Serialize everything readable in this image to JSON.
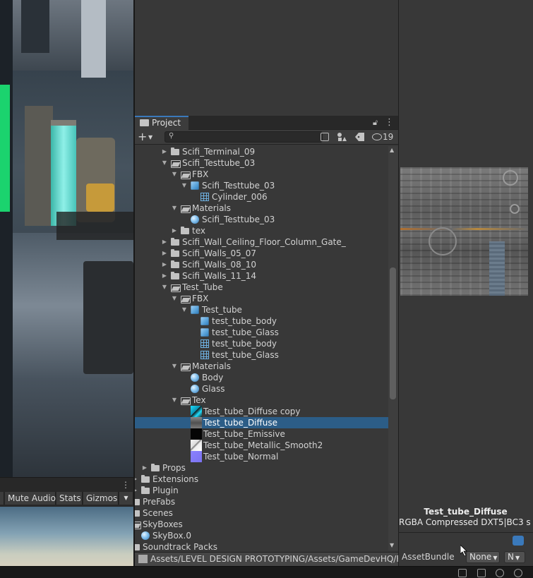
{
  "game_toolbar": {
    "mute_audio_label": "Mute Audio",
    "stats_label": "Stats",
    "gizmos_label": "Gizmos"
  },
  "project_panel": {
    "tab_label": "Project",
    "search": {
      "value": "",
      "placeholder": ""
    },
    "hidden_count": "19",
    "path": "Assets/LEVEL DESIGN PROTOTYPING/Assets/GameDevHQ/Fi"
  },
  "tree": [
    {
      "label": "Scifi_Terminal_09",
      "icon": "folder-icon",
      "expanded": false
    },
    {
      "label": "Scifi_Testtube_03",
      "icon": "folder-open-icon",
      "expanded": true
    },
    {
      "label": "FBX",
      "icon": "folder-open-icon",
      "expanded": true
    },
    {
      "label": "Scifi_Testtube_03",
      "icon": "model-icon",
      "expanded": true
    },
    {
      "label": "Cylinder_006",
      "icon": "mesh-icon"
    },
    {
      "label": "Materials",
      "icon": "folder-open-icon",
      "expanded": true
    },
    {
      "label": "Scifi_Testtube_03",
      "icon": "material-icon"
    },
    {
      "label": "tex",
      "icon": "folder-icon",
      "expanded": false
    },
    {
      "label": "Scifi_Wall_Ceiling_Floor_Column_Gate_",
      "icon": "folder-icon",
      "expanded": false
    },
    {
      "label": "Scifi_Walls_05_07",
      "icon": "folder-icon",
      "expanded": false
    },
    {
      "label": "Scifi_Walls_08_10",
      "icon": "folder-icon",
      "expanded": false
    },
    {
      "label": "Scifi_Walls_11_14",
      "icon": "folder-icon",
      "expanded": false
    },
    {
      "label": "Test_Tube",
      "icon": "folder-open-icon",
      "expanded": true
    },
    {
      "label": "FBX",
      "icon": "folder-open-icon",
      "expanded": true
    },
    {
      "label": "Test_tube",
      "icon": "model-icon",
      "expanded": true
    },
    {
      "label": "test_tube_body",
      "icon": "model-icon"
    },
    {
      "label": "test_tube_Glass",
      "icon": "model-icon"
    },
    {
      "label": "test_tube_body",
      "icon": "mesh-icon"
    },
    {
      "label": "test_tube_Glass",
      "icon": "mesh-icon"
    },
    {
      "label": "Materials",
      "icon": "folder-open-icon",
      "expanded": true
    },
    {
      "label": "Body",
      "icon": "material-icon"
    },
    {
      "label": "Glass",
      "icon": "material-icon"
    },
    {
      "label": "Tex",
      "icon": "folder-open-icon",
      "expanded": true
    },
    {
      "label": "Test_tube_Diffuse copy",
      "icon": "texture-diffuse-copy-icon"
    },
    {
      "label": "Test_tube_Diffuse",
      "icon": "texture-diffuse-icon",
      "selected": true
    },
    {
      "label": "Test_tube_Emissive",
      "icon": "texture-emissive-icon"
    },
    {
      "label": "Test_tube_Metallic_Smooth2",
      "icon": "texture-metallic-icon"
    },
    {
      "label": "Test_tube_Normal",
      "icon": "texture-normal-icon"
    },
    {
      "label": "Props",
      "icon": "folder-icon",
      "expanded": false
    },
    {
      "label": "Extensions",
      "icon": "folder-icon",
      "expanded": false
    },
    {
      "label": "Plugin",
      "icon": "folder-icon",
      "expanded": false
    },
    {
      "label": "PreFabs",
      "icon": "folder-icon",
      "expanded": false
    },
    {
      "label": "Scenes",
      "icon": "folder-icon",
      "expanded": false
    },
    {
      "label": "SkyBoxes",
      "icon": "folder-open-icon",
      "expanded": true
    },
    {
      "label": "SkyBox.0",
      "icon": "material-icon"
    },
    {
      "label": "Soundtrack Packs",
      "icon": "folder-icon",
      "expanded": false
    }
  ],
  "preview": {
    "asset_name": "Test_tube_Diffuse",
    "format": "RGBA Compressed DXT5|BC3 s",
    "assetbundle_label": "AssetBundle",
    "bundle_value": "None",
    "variant_value": "N"
  },
  "colors": {
    "selection": "#2c5d87",
    "accent": "#3a79bb",
    "panel": "#383838"
  }
}
